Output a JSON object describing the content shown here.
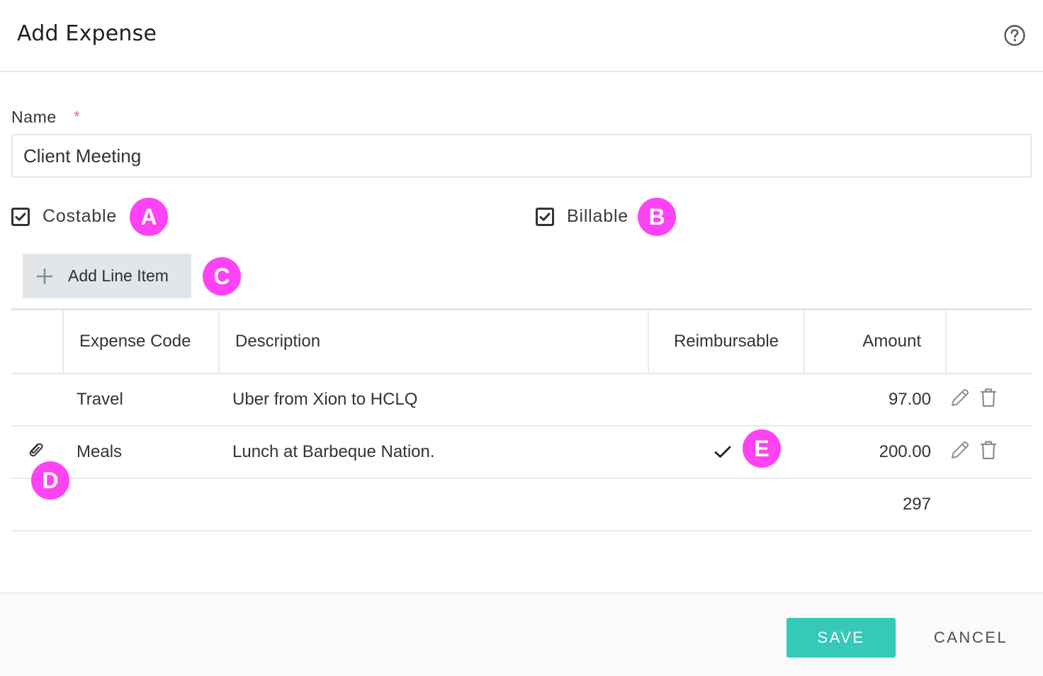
{
  "header": {
    "title": "Add Expense",
    "help_icon": "help-circle-icon"
  },
  "form": {
    "name_label": "Name",
    "required_marker": "*",
    "name_value": "Client Meeting",
    "costable": {
      "label": "Costable",
      "checked": true
    },
    "billable": {
      "label": "Billable",
      "checked": true
    },
    "add_line_item_label": "Add Line Item"
  },
  "annotations": {
    "a": "A",
    "b": "B",
    "c": "C",
    "d": "D",
    "e": "E",
    "color": "#ff42f4"
  },
  "table": {
    "columns": [
      "",
      "Expense Code",
      "Description",
      "Reimbursable",
      "Amount",
      ""
    ],
    "rows": [
      {
        "attachment": false,
        "code": "Travel",
        "description": "Uber from Xion to HCLQ",
        "reimbursable": false,
        "amount": "97.00"
      },
      {
        "attachment": true,
        "code": "Meals",
        "description": "Lunch at Barbeque Nation.",
        "reimbursable": true,
        "amount": "200.00"
      }
    ],
    "total": "297"
  },
  "footer": {
    "save_label": "SAVE",
    "cancel_label": "CANCEL",
    "save_color": "#35c9b8"
  }
}
